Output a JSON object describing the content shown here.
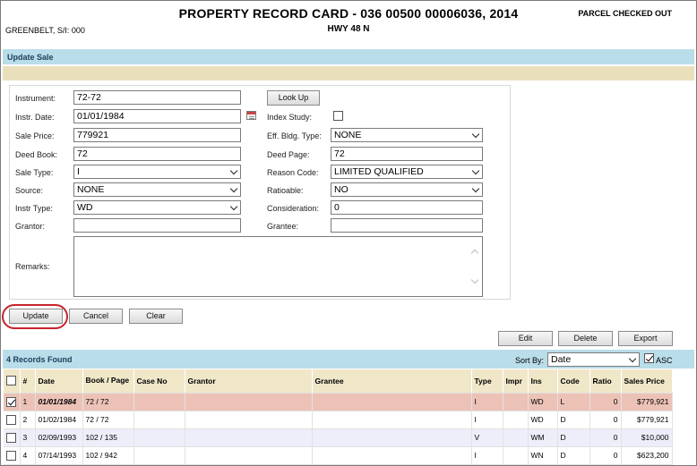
{
  "header": {
    "title": "PROPERTY RECORD CARD - 036 00500 00006036, 2014",
    "subtitle": "HWY 48 N",
    "status": "PARCEL CHECKED OUT",
    "parcel": "GREENBELT, S/I: 000"
  },
  "section_title": "Update Sale",
  "form": {
    "instrument": {
      "label": "Instrument:",
      "value": "72-72"
    },
    "lookup_label": "Look Up",
    "instr_date": {
      "label": "Instr. Date:",
      "value": "01/01/1984"
    },
    "index_study": {
      "label": "Index Study:",
      "checked": false
    },
    "sale_price": {
      "label": "Sale Price:",
      "value": "779921"
    },
    "eff_bldg_type": {
      "label": "Eff. Bldg. Type:",
      "value": "NONE"
    },
    "deed_book": {
      "label": "Deed Book:",
      "value": "72"
    },
    "deed_page": {
      "label": "Deed Page:",
      "value": "72"
    },
    "sale_type": {
      "label": "Sale Type:",
      "value": "I"
    },
    "reason_code": {
      "label": "Reason Code:",
      "value": "LIMITED QUALIFIED"
    },
    "source": {
      "label": "Source:",
      "value": "NONE"
    },
    "ratioable": {
      "label": "Ratioable:",
      "value": "NO"
    },
    "instr_type": {
      "label": "Instr Type:",
      "value": "WD"
    },
    "consideration": {
      "label": "Consideration:",
      "value": "0"
    },
    "grantor": {
      "label": "Grantor:",
      "value": ""
    },
    "grantee": {
      "label": "Grantee:",
      "value": ""
    },
    "remarks": {
      "label": "Remarks:",
      "value": ""
    }
  },
  "buttons": {
    "update": "Update",
    "cancel": "Cancel",
    "clear": "Clear",
    "edit": "Edit",
    "delete": "Delete",
    "export": "Export"
  },
  "records": {
    "count_label": "4 Records Found",
    "sort_label": "Sort By:",
    "sort_value": "Date",
    "asc_label": "ASC",
    "asc_checked": true,
    "columns": [
      "#",
      "Date",
      "Book / Page",
      "Case No",
      "Grantor",
      "Grantee",
      "Type",
      "Impr",
      "Ins",
      "Code",
      "Ratio",
      "Sales Price"
    ],
    "rows": [
      {
        "checked": true,
        "num": "1",
        "date": "01/01/1984",
        "book_page": "72 / 72",
        "case_no": "",
        "grantor": "",
        "grantee": "",
        "type": "I",
        "impr": "",
        "ins": "WD",
        "code": "L",
        "ratio": "0",
        "price": "$779,921"
      },
      {
        "checked": false,
        "num": "2",
        "date": "01/02/1984",
        "book_page": "72 / 72",
        "case_no": "",
        "grantor": "",
        "grantee": "",
        "type": "I",
        "impr": "",
        "ins": "WD",
        "code": "D",
        "ratio": "0",
        "price": "$779,921"
      },
      {
        "checked": false,
        "num": "3",
        "date": "02/09/1993",
        "book_page": "102 / 135",
        "case_no": "",
        "grantor": "",
        "grantee": "",
        "type": "V",
        "impr": "",
        "ins": "WM",
        "code": "D",
        "ratio": "0",
        "price": "$10,000"
      },
      {
        "checked": false,
        "num": "4",
        "date": "07/14/1993",
        "book_page": "102 / 942",
        "case_no": "",
        "grantor": "",
        "grantee": "",
        "type": "I",
        "impr": "",
        "ins": "WN",
        "code": "D",
        "ratio": "0",
        "price": "$623,200"
      }
    ]
  },
  "colors": {
    "accent_bar": "#b9dde9",
    "tan_bar": "#e9e0bb",
    "selected_row": "#ecc2b7",
    "highlight_ring": "#c8232c"
  }
}
